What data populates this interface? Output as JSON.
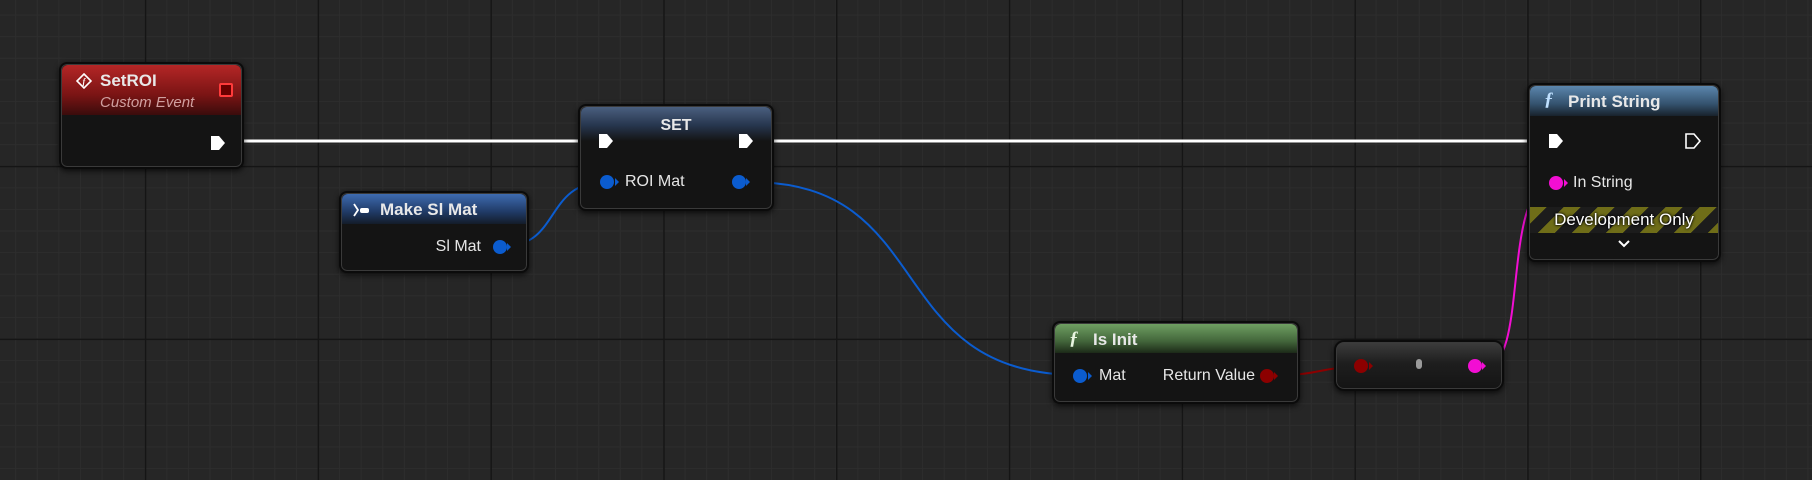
{
  "nodes": {
    "custom_event": {
      "title": "SetROI",
      "subtitle": "Custom Event"
    },
    "make_mat": {
      "title": "Make Sl Mat",
      "output_label": "Sl Mat"
    },
    "set": {
      "title": "SET",
      "pin_label": "ROI Mat"
    },
    "is_init": {
      "title": "Is Init",
      "input_label": "Mat",
      "output_label": "Return Value"
    },
    "print_string": {
      "title": "Print String",
      "input_label": "In String",
      "banner": "Development Only"
    }
  },
  "colors": {
    "exec": "#ffffff",
    "struct_pin": "#0b5ccf",
    "bool_pin": "#8c0000",
    "string_pin": "#f20ed3",
    "event_header": "#a11d1d",
    "var_header": "#2c4a7a",
    "pure_header": "#5f8d55",
    "func_header": "#4d7598"
  },
  "icons": {
    "event": "event-diamond-icon",
    "function": "function-f-icon",
    "make": "make-struct-icon",
    "expand": "chevron-down-icon",
    "delegate": "delegate-square-icon"
  }
}
